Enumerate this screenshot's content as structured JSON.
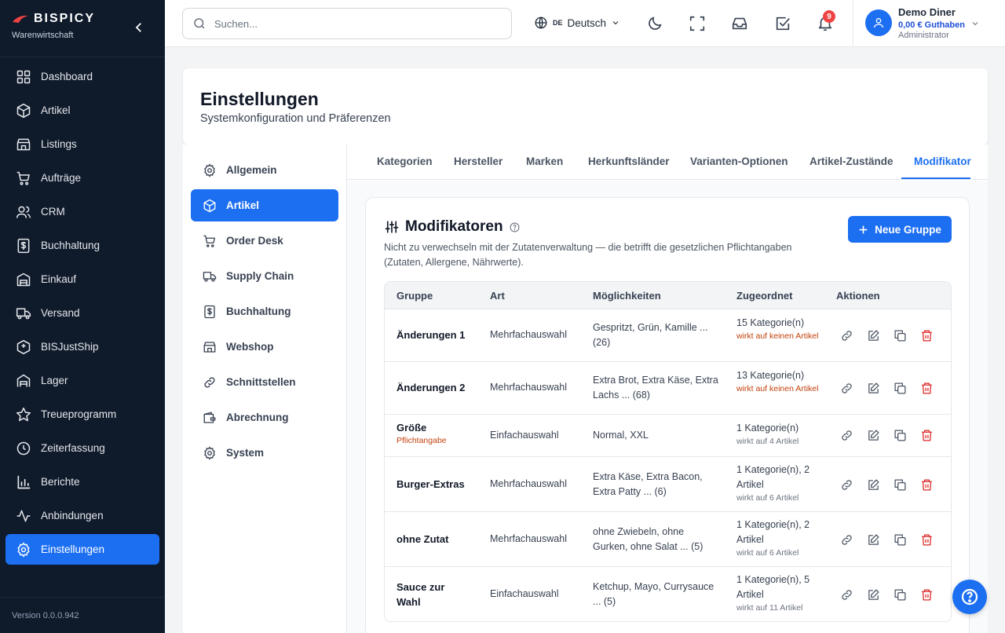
{
  "brand": {
    "name": "BISPICY",
    "subtitle": "Warenwirtschaft"
  },
  "sidebar": {
    "items": [
      {
        "label": "Dashboard",
        "icon": "dashboard-icon"
      },
      {
        "label": "Artikel",
        "icon": "box-icon"
      },
      {
        "label": "Listings",
        "icon": "store-icon"
      },
      {
        "label": "Aufträge",
        "icon": "cart-icon"
      },
      {
        "label": "CRM",
        "icon": "users-icon"
      },
      {
        "label": "Buchhaltung",
        "icon": "invoice-icon"
      },
      {
        "label": "Einkauf",
        "icon": "building-icon"
      },
      {
        "label": "Versand",
        "icon": "truck-icon"
      },
      {
        "label": "BISJustShip",
        "icon": "package-icon"
      },
      {
        "label": "Lager",
        "icon": "warehouse-icon"
      },
      {
        "label": "Treueprogramm",
        "icon": "star-icon"
      },
      {
        "label": "Zeiterfassung",
        "icon": "clock-icon"
      },
      {
        "label": "Berichte",
        "icon": "bar-chart-icon"
      },
      {
        "label": "Anbindungen",
        "icon": "activity-icon"
      },
      {
        "label": "Einstellungen",
        "icon": "gear-icon"
      }
    ],
    "active_index": 14,
    "version": "Version 0.0.0.942"
  },
  "topbar": {
    "search_placeholder": "Suchen...",
    "language_code": "DE",
    "language": "Deutsch",
    "notification_count": "9",
    "user_name": "Demo Diner",
    "user_balance": "0,00 € Guthaben",
    "user_role": "Administrator"
  },
  "page": {
    "title": "Einstellungen",
    "subtitle": "Systemkonfiguration und Präferenzen"
  },
  "settings_nav": {
    "items": [
      {
        "label": "Allgemein",
        "icon": "gear-icon"
      },
      {
        "label": "Artikel",
        "icon": "box-icon"
      },
      {
        "label": "Order Desk",
        "icon": "cart-icon"
      },
      {
        "label": "Supply Chain",
        "icon": "truck-icon"
      },
      {
        "label": "Buchhaltung",
        "icon": "invoice-icon"
      },
      {
        "label": "Webshop",
        "icon": "store-icon"
      },
      {
        "label": "Schnittstellen",
        "icon": "link-icon"
      },
      {
        "label": "Abrechnung",
        "icon": "wallet-icon"
      },
      {
        "label": "System",
        "icon": "gear-icon"
      }
    ],
    "active_index": 1
  },
  "tabs": {
    "items": [
      "Kategorien",
      "Hersteller",
      "Marken",
      "Herkunftsländer",
      "Varianten-Optionen",
      "Artikel-Zustände",
      "Modifikator"
    ],
    "active_index": 6
  },
  "modifiers": {
    "title": "Modifikatoren",
    "description": "Nicht zu verwechseln mit der Zutatenverwaltung — die betrifft die gesetzlichen Pflichtangaben (Zutaten, Allergene, Nährwerte).",
    "new_group_label": "Neue Gruppe",
    "columns": [
      "Gruppe",
      "Art",
      "Möglichkeiten",
      "Zugeordnet",
      "Aktionen"
    ],
    "rows": [
      {
        "group": "Änderungen 1",
        "required": "",
        "type": "Mehrfachauswahl",
        "options": "Gespritzt, Grün, Kamille ... (26)",
        "assigned": "15 Kategorie(n)",
        "note": "wirkt auf keinen Artikel",
        "note_warn": true
      },
      {
        "group": "Änderungen 2",
        "required": "",
        "type": "Mehrfachauswahl",
        "options": "Extra Brot, Extra Käse, Extra Lachs ... (68)",
        "assigned": "13 Kategorie(n)",
        "note": "wirkt auf keinen Artikel",
        "note_warn": true
      },
      {
        "group": "Größe",
        "required": "Pflichtangabe",
        "type": "Einfachauswahl",
        "options": "Normal, XXL",
        "assigned": "1 Kategorie(n)",
        "note": "wirkt auf 4 Artikel",
        "note_warn": false
      },
      {
        "group": "Burger-Extras",
        "required": "",
        "type": "Mehrfachauswahl",
        "options": "Extra Käse, Extra Bacon, Extra Patty ... (6)",
        "assigned": "1 Kategorie(n), 2 Artikel",
        "note": "wirkt auf 6 Artikel",
        "note_warn": false
      },
      {
        "group": "ohne Zutat",
        "required": "",
        "type": "Mehrfachauswahl",
        "options": "ohne Zwiebeln, ohne Gurken, ohne Salat ... (5)",
        "assigned": "1 Kategorie(n), 2 Artikel",
        "note": "wirkt auf 6 Artikel",
        "note_warn": false
      },
      {
        "group": "Sauce zur Wahl",
        "required": "",
        "type": "Einfachauswahl",
        "options": "Ketchup, Mayo, Currysauce ... (5)",
        "assigned": "1 Kategorie(n), 5 Artikel",
        "note": "wirkt auf 11 Artikel",
        "note_warn": false
      }
    ]
  },
  "colors": {
    "accent": "#1d6ff2",
    "sidebar_bg": "#0f1a2b",
    "danger": "#dc2626",
    "warning_text": "#c2410c"
  }
}
